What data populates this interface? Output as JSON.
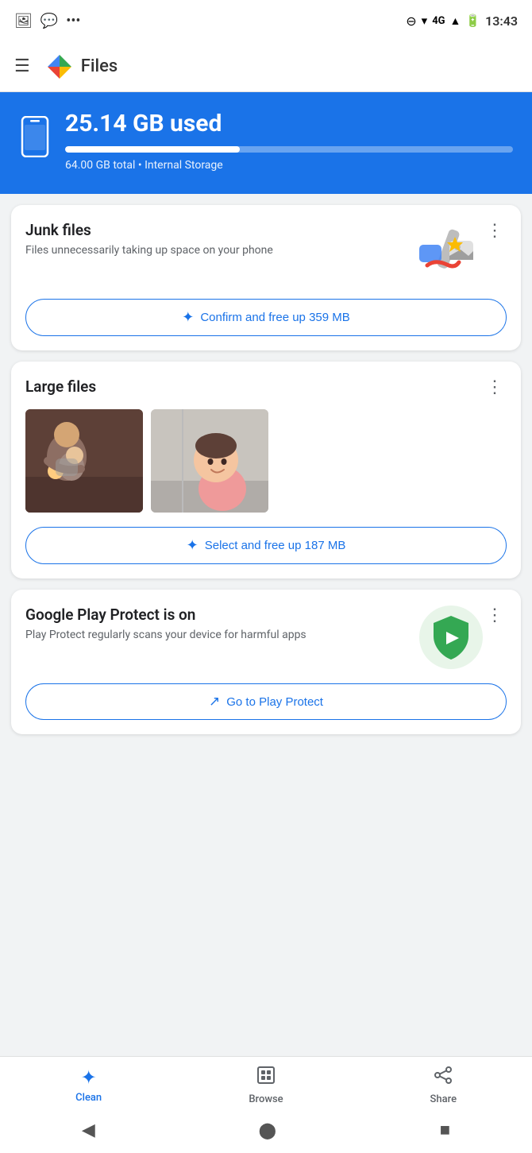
{
  "statusBar": {
    "time": "13:43",
    "icons": [
      "photo-icon",
      "whatsapp-icon",
      "dots-icon",
      "dnd-icon",
      "wifi-icon",
      "signal-icon",
      "battery-icon"
    ]
  },
  "appBar": {
    "menuLabel": "≡",
    "title": "Files",
    "logoAlt": "Files app logo"
  },
  "storage": {
    "usedLabel": "25.14 GB used",
    "totalLabel": "64.00 GB total • Internal Storage",
    "usedPercent": 39
  },
  "cards": {
    "junkFiles": {
      "title": "Junk files",
      "subtitle": "Files unnecessarily taking up space on your phone",
      "actionLabel": "Confirm and free up 359 MB",
      "moreLabel": "⋮"
    },
    "largeFiles": {
      "title": "Large files",
      "actionLabel": "Select and free up 187 MB",
      "moreLabel": "⋮"
    },
    "playProtect": {
      "title": "Google Play Protect is on",
      "subtitle": "Play Protect regularly scans your device for harmful apps",
      "actionLabel": "Go to Play Protect",
      "moreLabel": "⋮"
    }
  },
  "bottomNav": {
    "items": [
      {
        "id": "clean",
        "label": "Clean",
        "active": true
      },
      {
        "id": "browse",
        "label": "Browse",
        "active": false
      },
      {
        "id": "share",
        "label": "Share",
        "active": false
      }
    ]
  },
  "systemNav": {
    "back": "◀",
    "home": "⬤",
    "recents": "■"
  }
}
